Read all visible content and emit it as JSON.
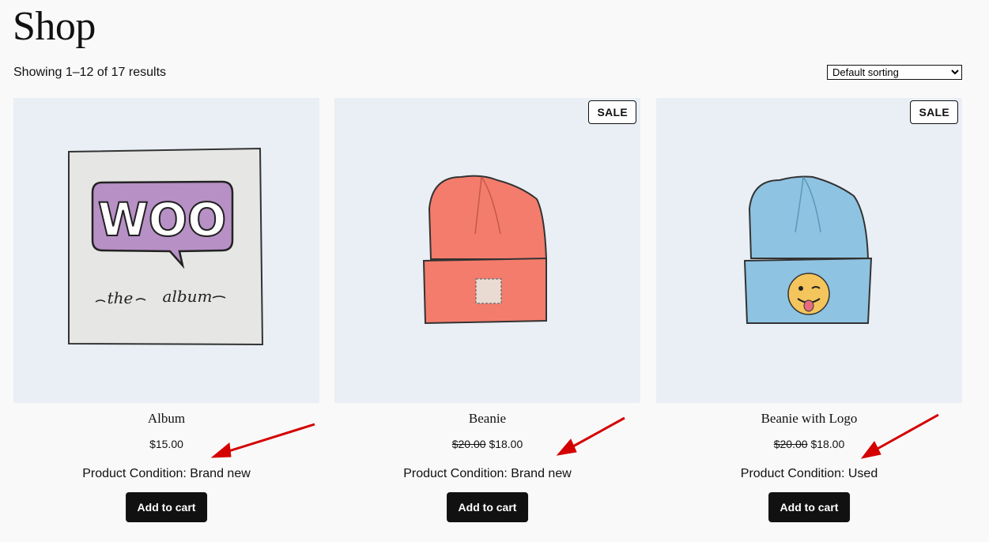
{
  "page": {
    "title": "Shop"
  },
  "toolbar": {
    "result_count": "Showing 1–12 of 17 results",
    "sorting": {
      "selected": "Default sorting",
      "options": [
        "Default sorting"
      ]
    }
  },
  "products": [
    {
      "title": "Album",
      "price": "$15.00",
      "regular_price": "",
      "sale_badge": "",
      "condition": "Product Condition: Brand new",
      "button": "Add to cart",
      "image_text": [
        "WOO",
        "the",
        "album"
      ]
    },
    {
      "title": "Beanie",
      "price": "$18.00",
      "regular_price": "$20.00",
      "sale_badge": "SALE",
      "condition": "Product Condition: Brand new",
      "button": "Add to cart"
    },
    {
      "title": "Beanie with Logo",
      "price": "$18.00",
      "regular_price": "$20.00",
      "sale_badge": "SALE",
      "condition": "Product Condition: Used",
      "button": "Add to cart"
    }
  ],
  "colors": {
    "background": "#f9f9f9",
    "image_background": "#e9eff4",
    "button": "#111111",
    "arrow": "#d40000",
    "beanie_orange": "#f47c6c",
    "beanie_blue": "#8ec3e2",
    "woo_purple": "#b790c6"
  }
}
